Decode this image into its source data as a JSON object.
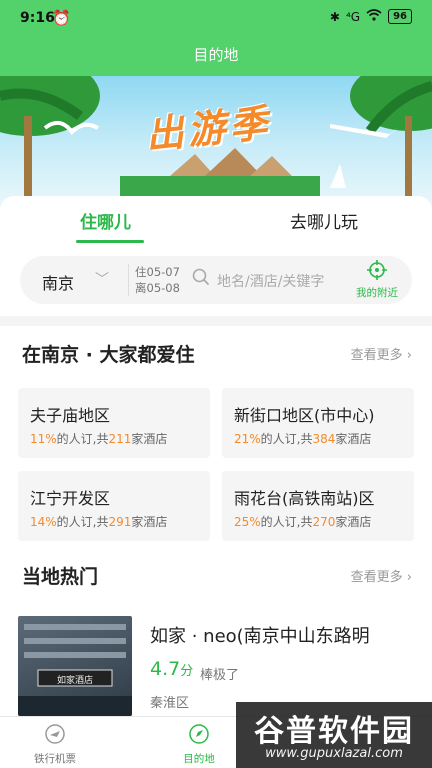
{
  "status": {
    "time": "9:16",
    "battery": "96",
    "signal": "⁴G"
  },
  "nav": {
    "title": "目的地"
  },
  "banner": {
    "text": "出游季"
  },
  "tabs": [
    {
      "label": "住哪儿"
    },
    {
      "label": "去哪儿玩"
    }
  ],
  "search": {
    "city": "南京",
    "checkin": "住05-07",
    "checkout": "离05-08",
    "placeholder": "地名/酒店/关键字",
    "nearby": "我的附近"
  },
  "popular_areas": {
    "title": "在南京 · 大家都爱住",
    "more": "查看更多",
    "items": [
      {
        "name": "夫子庙地区",
        "pct": "11%",
        "mid": "的人订,共",
        "count": "211",
        "suffix": "家酒店"
      },
      {
        "name": "新街口地区(市中心)",
        "pct": "21%",
        "mid": "的人订,共",
        "count": "384",
        "suffix": "家酒店"
      },
      {
        "name": "江宁开发区",
        "pct": "14%",
        "mid": "的人订,共",
        "count": "291",
        "suffix": "家酒店"
      },
      {
        "name": "雨花台(高铁南站)区",
        "pct": "25%",
        "mid": "的人订,共",
        "count": "270",
        "suffix": "家酒店"
      }
    ]
  },
  "local_hot": {
    "title": "当地热门",
    "more": "查看更多",
    "hotel": {
      "name": "如家 · neo(南京中山东路明",
      "score": "4.7",
      "score_unit": "分",
      "level": "棒极了",
      "district": "秦淮区",
      "sign": "如家酒店"
    }
  },
  "bottom_nav": [
    {
      "label": "铁行机票"
    },
    {
      "label": "目的地"
    }
  ],
  "watermark": {
    "title": "谷普软件园",
    "url": "www.gupuxlazal.com"
  },
  "colors": {
    "green": "#53d26b",
    "accent_green": "#2cb84a",
    "orange": "#f58a2a"
  }
}
